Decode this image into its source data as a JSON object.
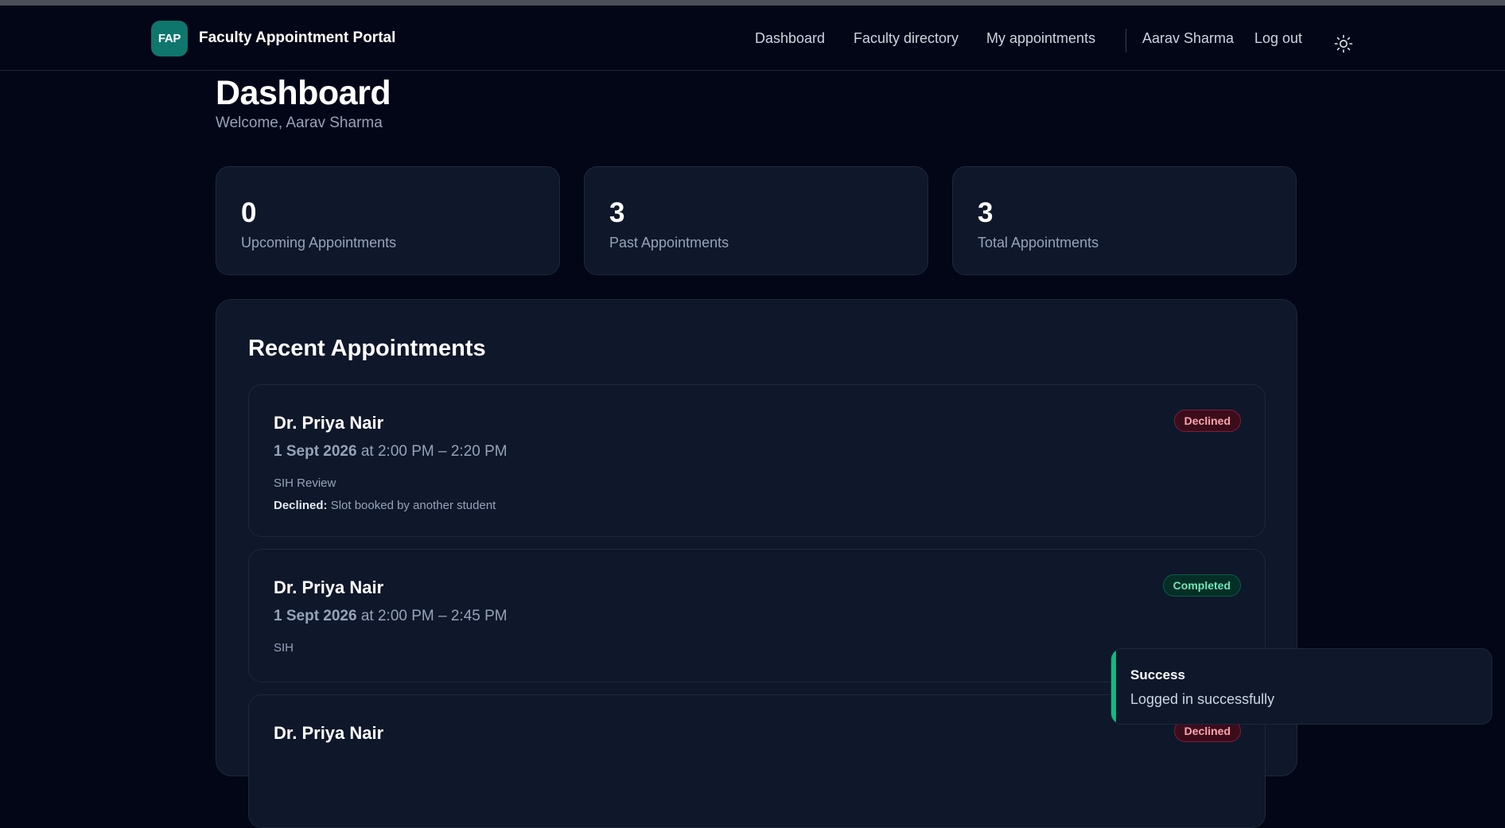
{
  "nav": {
    "logo_text": "FAP",
    "brand": "Faculty Appointment Portal",
    "links": [
      "Dashboard",
      "Faculty directory",
      "My appointments"
    ],
    "user_name": "Aarav Sharma",
    "logout_label": "Log out",
    "theme_icon": "sun-icon"
  },
  "header": {
    "title": "Dashboard",
    "welcome": "Welcome, Aarav Sharma"
  },
  "stats": [
    {
      "value": "0",
      "label": "Upcoming Appointments"
    },
    {
      "value": "3",
      "label": "Past Appointments"
    },
    {
      "value": "3",
      "label": "Total Appointments"
    }
  ],
  "recent": {
    "title": "Recent Appointments",
    "items": [
      {
        "faculty": "Dr. Priya Nair",
        "date": "1 Sept 2026",
        "time": "at 2:00 PM – 2:20 PM",
        "purpose": "SIH Review",
        "status": "Declined",
        "note_label": "Declined:",
        "note_text": "Slot booked by another student"
      },
      {
        "faculty": "Dr. Priya Nair",
        "date": "1 Sept 2026",
        "time": "at 2:00 PM – 2:45 PM",
        "purpose": "SIH",
        "status": "Completed"
      },
      {
        "faculty": "Dr. Priya Nair",
        "status": "Declined"
      }
    ]
  },
  "toast": {
    "title": "Success",
    "message": "Logged in successfully"
  },
  "colors": {
    "background": "#020617",
    "card": "#0f172a",
    "accent_teal": "#0f766e",
    "success_green": "#10b981",
    "declined_text": "#fda4af",
    "completed_text": "#6ee7b7"
  }
}
